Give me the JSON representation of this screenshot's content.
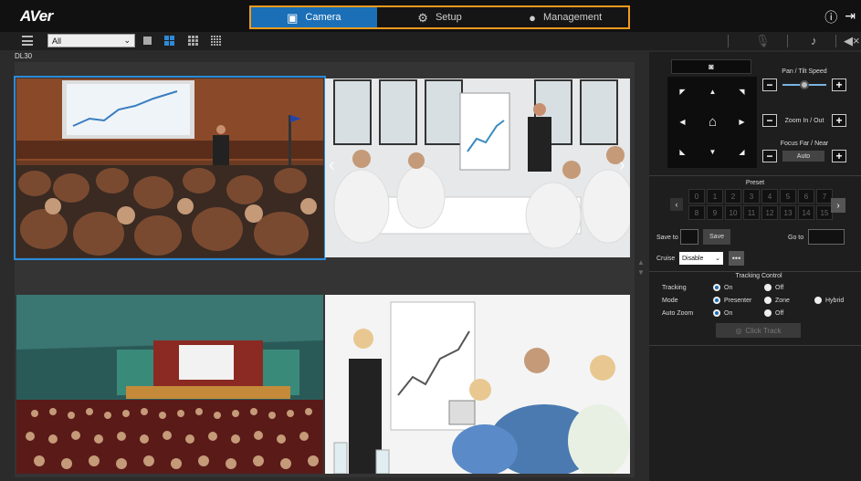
{
  "app": {
    "logo": "AVer"
  },
  "tabs": [
    {
      "label": "Camera",
      "icon": "camera-icon",
      "active": true
    },
    {
      "label": "Setup",
      "icon": "gear-icon",
      "active": false
    },
    {
      "label": "Management",
      "icon": "user-icon",
      "active": false
    }
  ],
  "toolbar": {
    "group_select": "All"
  },
  "device": {
    "name": "DL30"
  },
  "ptz": {
    "pan_tilt_speed_label": "Pan / Tilt Speed",
    "pan_tilt_speed": 0.5,
    "zoom_label": "Zoom In / Out",
    "focus_label": "Focus Far / Near",
    "focus_mode": "Auto"
  },
  "preset": {
    "title": "Preset",
    "row1": [
      "0",
      "1",
      "2",
      "3",
      "4",
      "5",
      "6",
      "7"
    ],
    "row2": [
      "8",
      "9",
      "10",
      "11",
      "12",
      "13",
      "14",
      "15"
    ],
    "save_to_label": "Save to",
    "save_button": "Save",
    "go_to_label": "Go to",
    "cruise_label": "Cruise",
    "cruise_value": "Disable"
  },
  "tracking": {
    "title": "Tracking Control",
    "tracking_label": "Tracking",
    "tracking_on": "On",
    "tracking_off": "Off",
    "mode_label": "Mode",
    "mode_presenter": "Presenter",
    "mode_zone": "Zone",
    "mode_hybrid": "Hybrid",
    "autozoom_label": "Auto Zoom",
    "autozoom_on": "On",
    "autozoom_off": "Off",
    "click_track": "Click Track"
  },
  "colors": {
    "accent": "#1a6fb6",
    "highlight_border": "#f39a1e",
    "selection": "#2e8ad6"
  }
}
